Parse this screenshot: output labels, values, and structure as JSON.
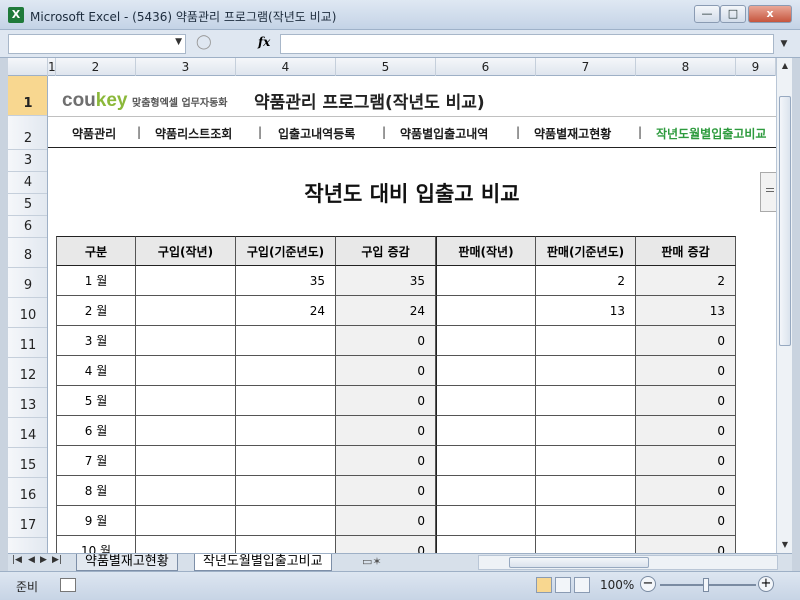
{
  "window": {
    "title": "Microsoft Excel - (5436) 약품관리 프로그램(작년도 비교)",
    "app_icon": "X",
    "minimize": "—",
    "maximize": "□",
    "close": "x"
  },
  "formula_bar": {
    "name_box": "",
    "fx": "fx",
    "formula": ""
  },
  "columns": [
    "1",
    "2",
    "3",
    "4",
    "5",
    "6",
    "7",
    "8",
    "9"
  ],
  "rows": [
    "1",
    "2",
    "3",
    "4",
    "5",
    "6",
    "8",
    "9",
    "10",
    "11",
    "12",
    "13",
    "14",
    "15",
    "16",
    "17"
  ],
  "sheet": {
    "logo_main": "cou",
    "logo_accent": "key",
    "logo_sub": "맞춤형엑셀 업무자동화",
    "app_title": "약품관리 프로그램(작년도 비교)",
    "nav": [
      "약품관리",
      "약품리스트조회",
      "입출고내역등록",
      "약품별입출고내역",
      "약품별재고현황",
      "작년도월별입출고비교"
    ],
    "title": "작년도 대비 입출고 비교"
  },
  "table": {
    "headers": [
      "구분",
      "구입(작년)",
      "구입(기준년도)",
      "구입 증감",
      "판매(작년)",
      "판매(기준년도)",
      "판매 증감"
    ],
    "rows": [
      [
        "1 월",
        "",
        "35",
        "35",
        "",
        "2",
        "2"
      ],
      [
        "2 월",
        "",
        "24",
        "24",
        "",
        "13",
        "13"
      ],
      [
        "3 월",
        "",
        "",
        "0",
        "",
        "",
        "0"
      ],
      [
        "4 월",
        "",
        "",
        "0",
        "",
        "",
        "0"
      ],
      [
        "5 월",
        "",
        "",
        "0",
        "",
        "",
        "0"
      ],
      [
        "6 월",
        "",
        "",
        "0",
        "",
        "",
        "0"
      ],
      [
        "7 월",
        "",
        "",
        "0",
        "",
        "",
        "0"
      ],
      [
        "8 월",
        "",
        "",
        "0",
        "",
        "",
        "0"
      ],
      [
        "9 월",
        "",
        "",
        "0",
        "",
        "",
        "0"
      ],
      [
        "10 월",
        "",
        "",
        "0",
        "",
        "",
        "0"
      ]
    ]
  },
  "tabs": {
    "items": [
      "약품별재고현황",
      "작년도월별입출고비교"
    ],
    "active_index": 1
  },
  "status": {
    "ready": "준비",
    "zoom": "100%",
    "zoom_percent": 100
  }
}
